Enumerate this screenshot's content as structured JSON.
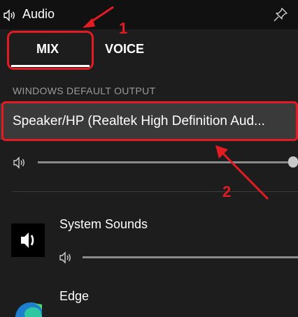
{
  "title": {
    "text": "Audio",
    "icon": "speaker-icon",
    "pin_icon": "pin-icon"
  },
  "tabs": [
    {
      "label": "MIX",
      "selected": true
    },
    {
      "label": "VOICE",
      "selected": false
    }
  ],
  "output": {
    "section_label": "WINDOWS DEFAULT OUTPUT",
    "device": "Speaker/HP (Realtek High Definition Aud...",
    "volume_fraction": 1.0
  },
  "apps": [
    {
      "name": "System Sounds",
      "icon": "speaker-icon",
      "volume_fraction": 1.0
    },
    {
      "name": "Edge",
      "icon": "edge-icon"
    }
  ],
  "annotations": [
    {
      "number": "1"
    },
    {
      "number": "2"
    }
  ],
  "colors": {
    "background": "#1d1d1d",
    "titlebar": "#111111",
    "device_box": "#3a3a3a",
    "annotation": "#e31b23"
  }
}
